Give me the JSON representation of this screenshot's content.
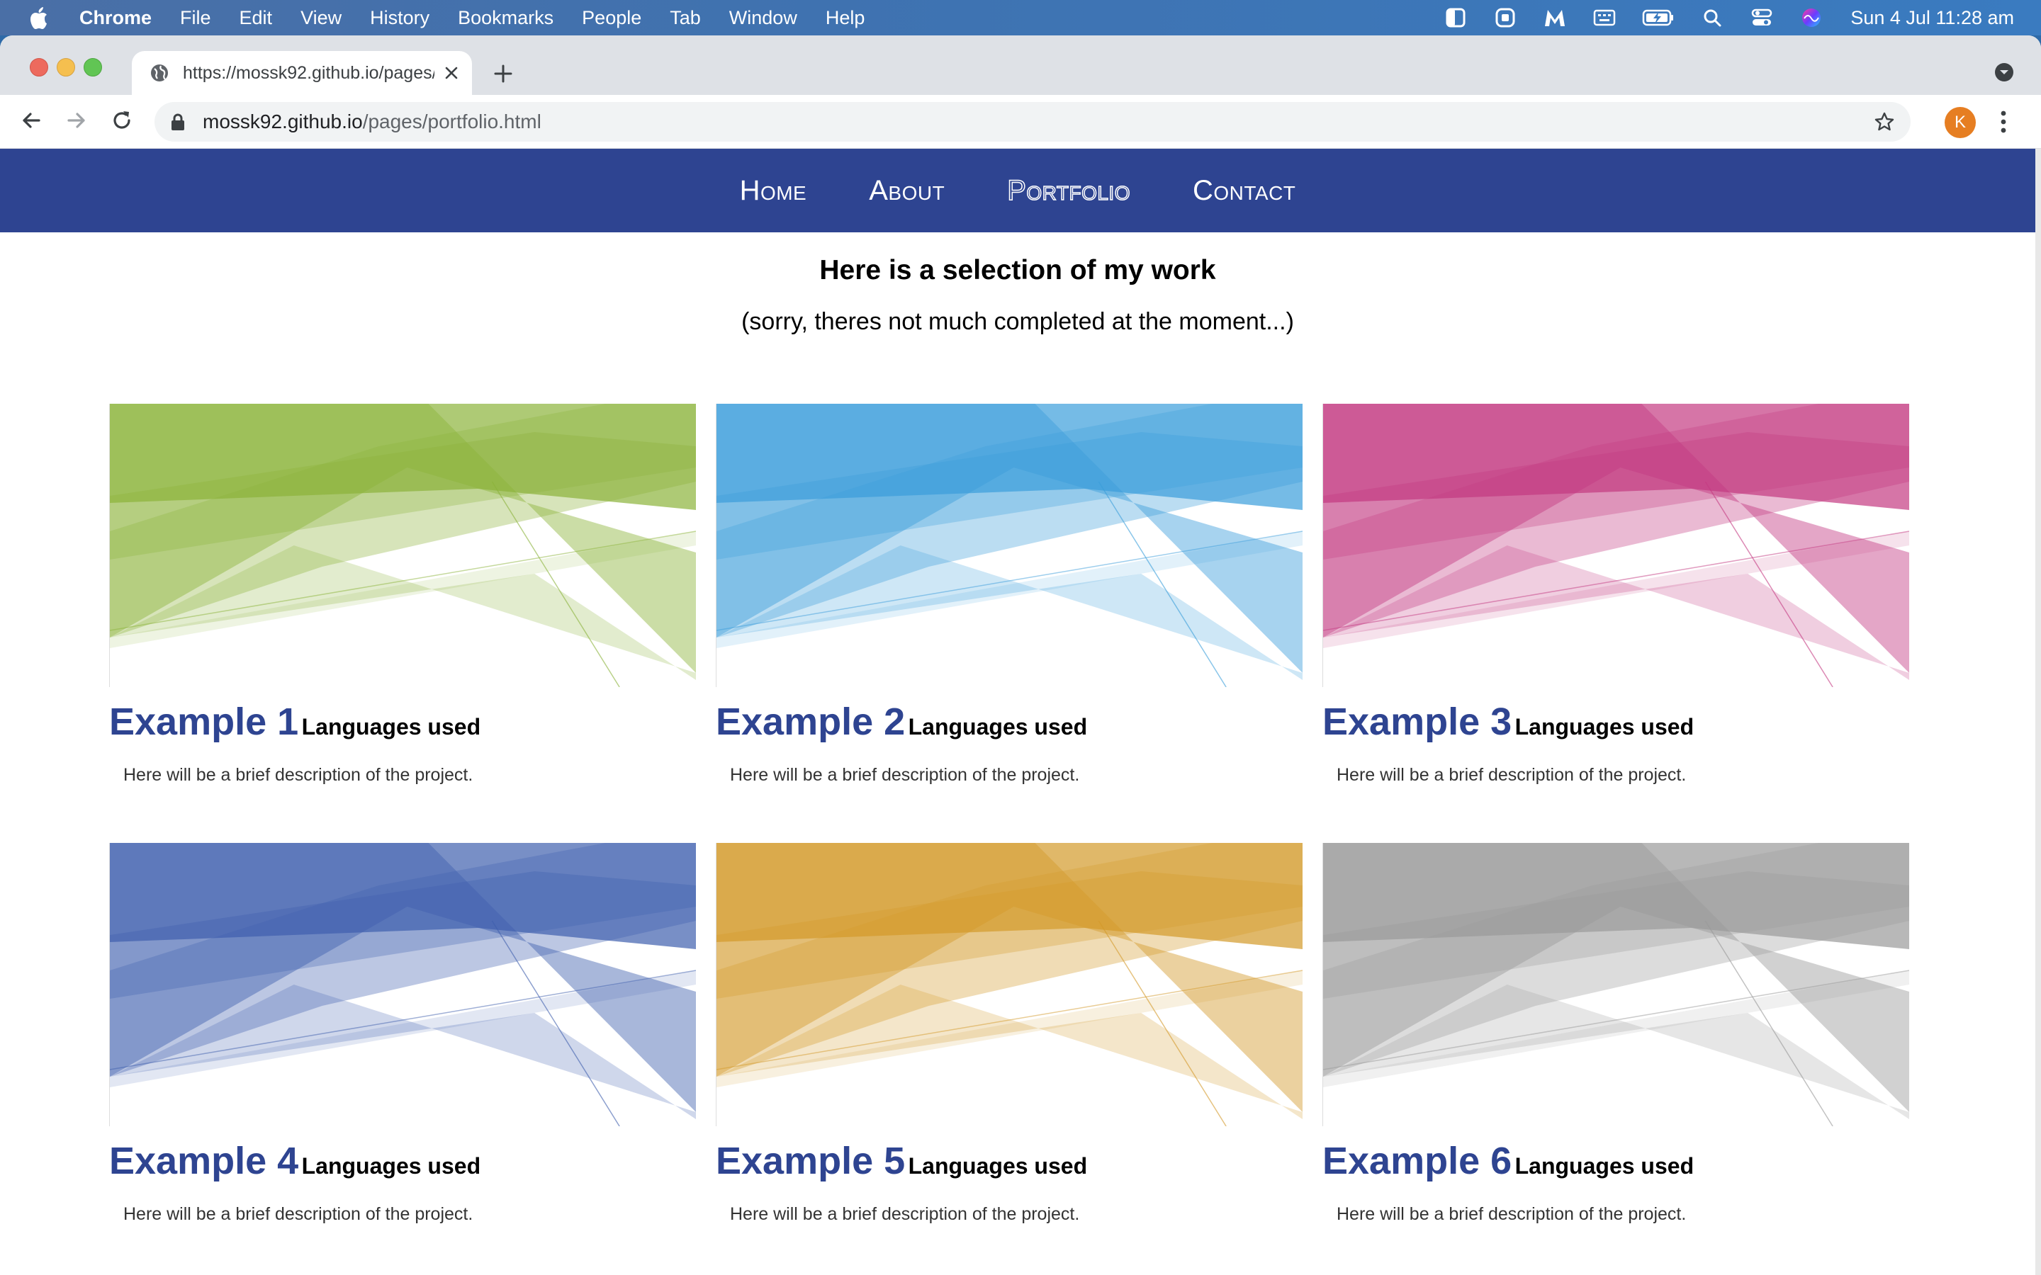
{
  "menubar": {
    "app_name": "Chrome",
    "items": [
      "File",
      "Edit",
      "View",
      "History",
      "Bookmarks",
      "People",
      "Tab",
      "Window",
      "Help"
    ],
    "clock": "Sun 4 Jul  11:28 am"
  },
  "browser": {
    "tab_title": "https://mossk92.github.io/pages/portfolio.html",
    "url_host": "mossk92.github.io",
    "url_path": "/pages/portfolio.html",
    "profile_initial": "K"
  },
  "site": {
    "nav": [
      "Home",
      "About",
      "Portfolio",
      "Contact"
    ],
    "active_nav": "Portfolio",
    "heading": "Here is a selection of my work",
    "subheading": "(sorry, theres not much completed at the moment...)",
    "colors": {
      "brand": "#2e4491"
    },
    "projects": [
      {
        "title": "Example 1",
        "subtitle": "Languages used",
        "description": "Here will be a brief description of the project.",
        "color": "#8bb33a"
      },
      {
        "title": "Example 2",
        "subtitle": "Languages used",
        "description": "Here will be a brief description of the project.",
        "color": "#3b9edb"
      },
      {
        "title": "Example 3",
        "subtitle": "Languages used",
        "description": "Here will be a brief description of the project.",
        "color": "#c43a82"
      },
      {
        "title": "Example 4",
        "subtitle": "Languages used",
        "description": "Here will be a brief description of the project.",
        "color": "#3f5fae"
      },
      {
        "title": "Example 5",
        "subtitle": "Languages used",
        "description": "Here will be a brief description of the project.",
        "color": "#d39a2a"
      },
      {
        "title": "Example 6",
        "subtitle": "Languages used",
        "description": "Here will be a brief description of the project.",
        "color": "#9a9a9a"
      }
    ]
  }
}
